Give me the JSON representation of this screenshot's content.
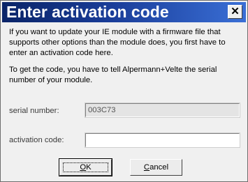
{
  "window": {
    "title": "Enter activation code",
    "close_glyph": "✕"
  },
  "message": {
    "paragraph1": "If you want to update your IE module with a firmware file that supports other options than the module does, you first have to enter an activation code here.",
    "paragraph2": "To get the code, you have to tell Alpermann+Velte the serial number of your module."
  },
  "form": {
    "serial_label": "serial number:",
    "serial_value": "003C73",
    "activation_label": "activation code:",
    "activation_value": ""
  },
  "buttons": {
    "ok_mnemonic": "O",
    "ok_rest": "K",
    "cancel_mnemonic": "C",
    "cancel_rest": "ancel"
  }
}
